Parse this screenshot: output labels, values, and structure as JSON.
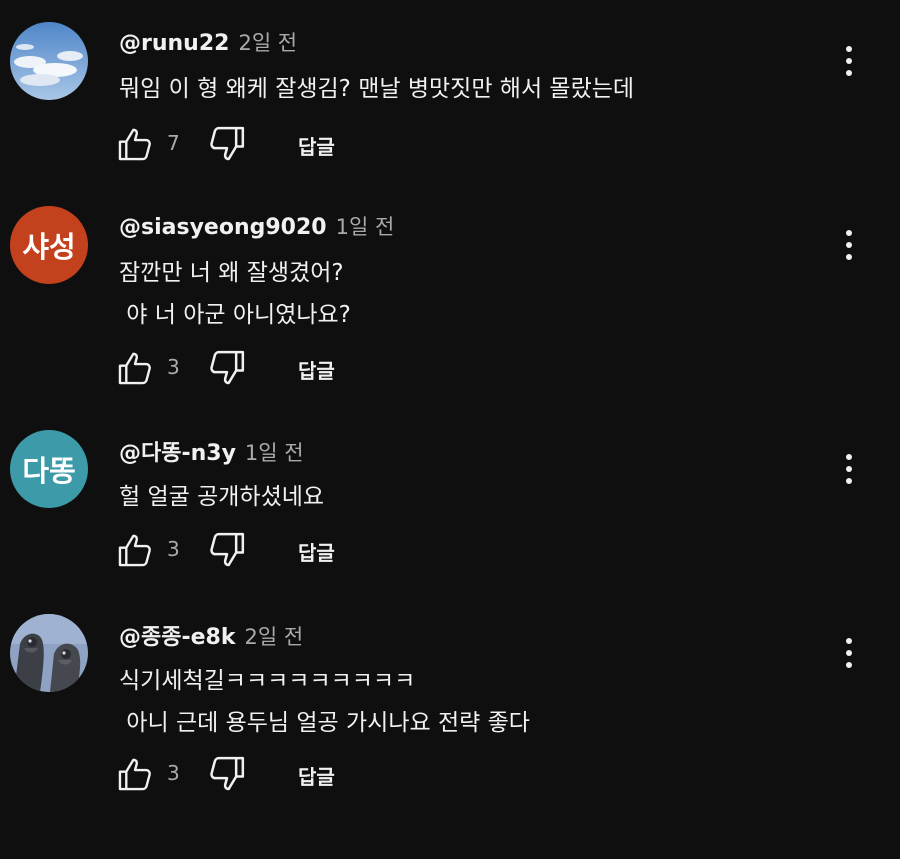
{
  "comments": [
    {
      "author": "@runu22",
      "time": "2일 전",
      "avatar": {
        "type": "image",
        "description": "sky-clouds",
        "color": "#6f9ed0"
      },
      "lines": [
        "뭐임 이 형 왜케 잘생김? 맨날 병맛짓만 해서 몰랐는데"
      ],
      "likes": "7",
      "reply_label": "답글"
    },
    {
      "author": "@siasyeong9020",
      "time": "1일 전",
      "avatar": {
        "type": "initials",
        "text": "샤성",
        "color": "#c4411e"
      },
      "lines": [
        "잠깐만 너 왜 잘생겼어?",
        " 야 너 아군 아니였나요?"
      ],
      "likes": "3",
      "reply_label": "답글"
    },
    {
      "author": "@다똥-n3y",
      "time": "1일 전",
      "avatar": {
        "type": "initials",
        "text": "다똥",
        "color": "#3d9aa8"
      },
      "lines": [
        "헐 얼굴 공개하셨네요"
      ],
      "likes": "3",
      "reply_label": "답글"
    },
    {
      "author": "@종종-e8k",
      "time": "2일 전",
      "avatar": {
        "type": "image",
        "description": "two-birds",
        "color": "#8ea2c4"
      },
      "lines": [
        "식기세척길ㅋㅋㅋㅋㅋㅋㅋㅋㅋ",
        " 아니 근데 용두님 얼공 가시나요 전략 좋다"
      ],
      "likes": "3",
      "reply_label": "답글"
    }
  ],
  "colors": {
    "background": "#0f0f0f",
    "text_primary": "#f1f1f1",
    "text_secondary": "#aaaaaa"
  },
  "icons": [
    "thumb-up-icon",
    "thumb-down-icon",
    "more-vert-icon"
  ]
}
